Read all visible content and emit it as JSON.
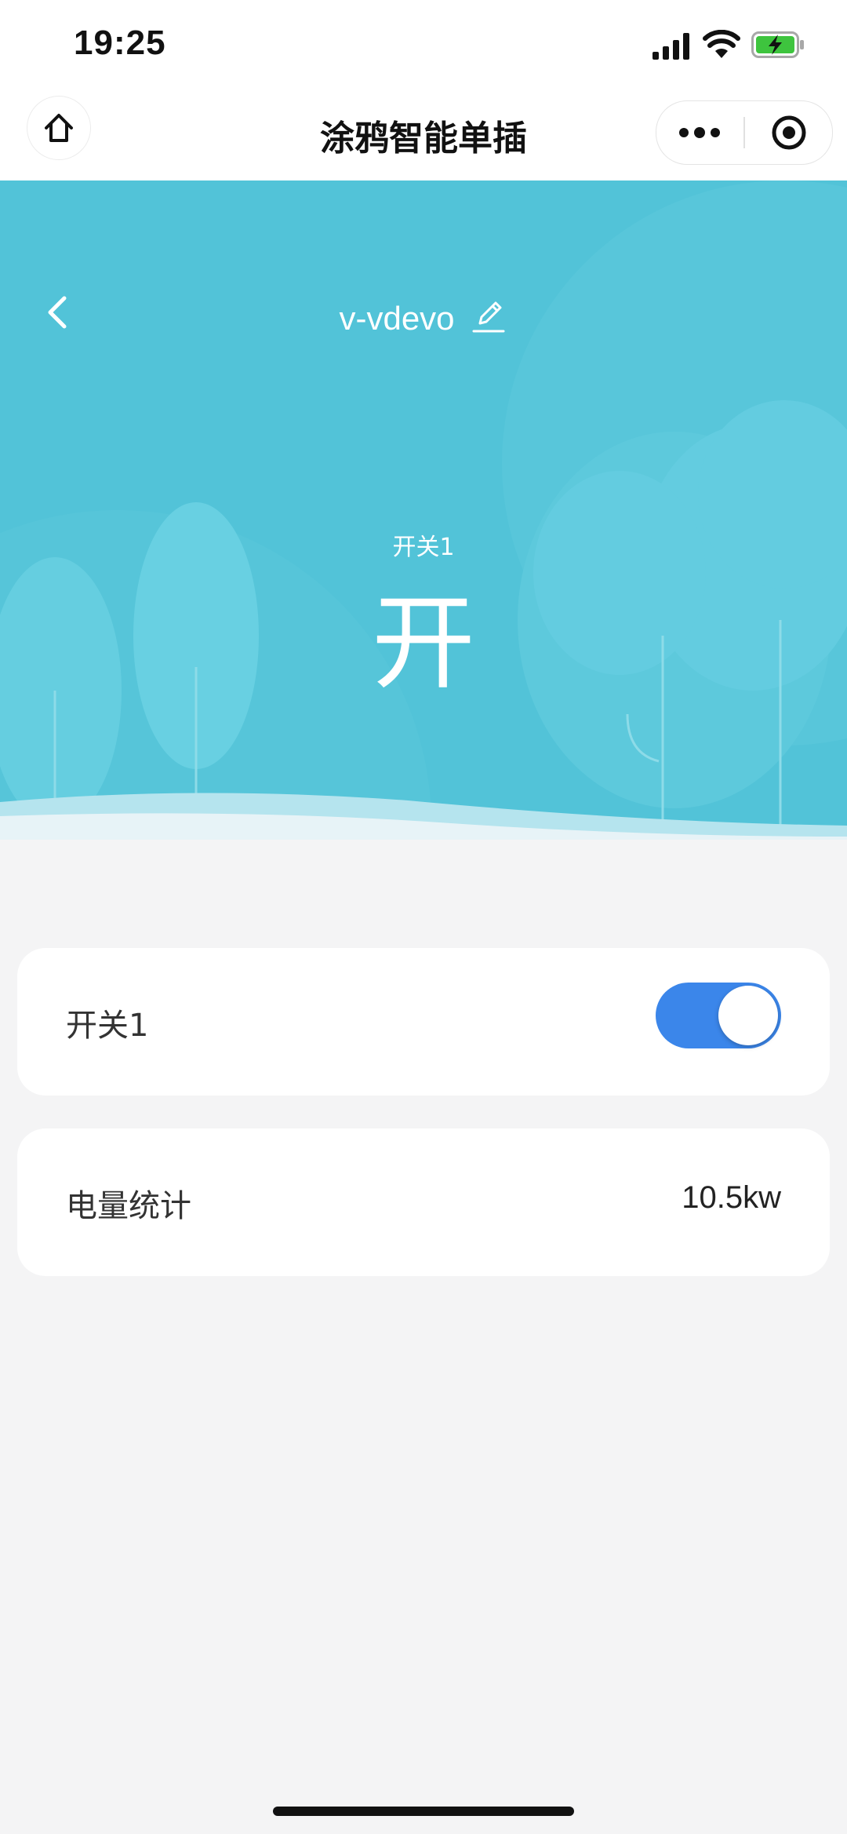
{
  "status_bar": {
    "time": "19:25",
    "icons": [
      "signal-icon",
      "wifi-icon",
      "battery-charging-icon"
    ],
    "battery_color": "#3ec43e"
  },
  "nav_bar": {
    "title": "涂鸦智能单插",
    "icons": [
      "home-icon",
      "more-icon",
      "close-target-icon"
    ]
  },
  "hero": {
    "device_name": "v-vdevo",
    "switch_label": "开关1",
    "switch_state": "开",
    "background_color": "#52c3d8",
    "icons": [
      "back-chevron-icon",
      "edit-pencil-icon"
    ]
  },
  "controls": {
    "switch_row": {
      "label": "开关1",
      "on": true,
      "toggle_color": "#3b86ea"
    },
    "energy_row": {
      "label": "电量统计",
      "value": "10.5kw"
    }
  }
}
